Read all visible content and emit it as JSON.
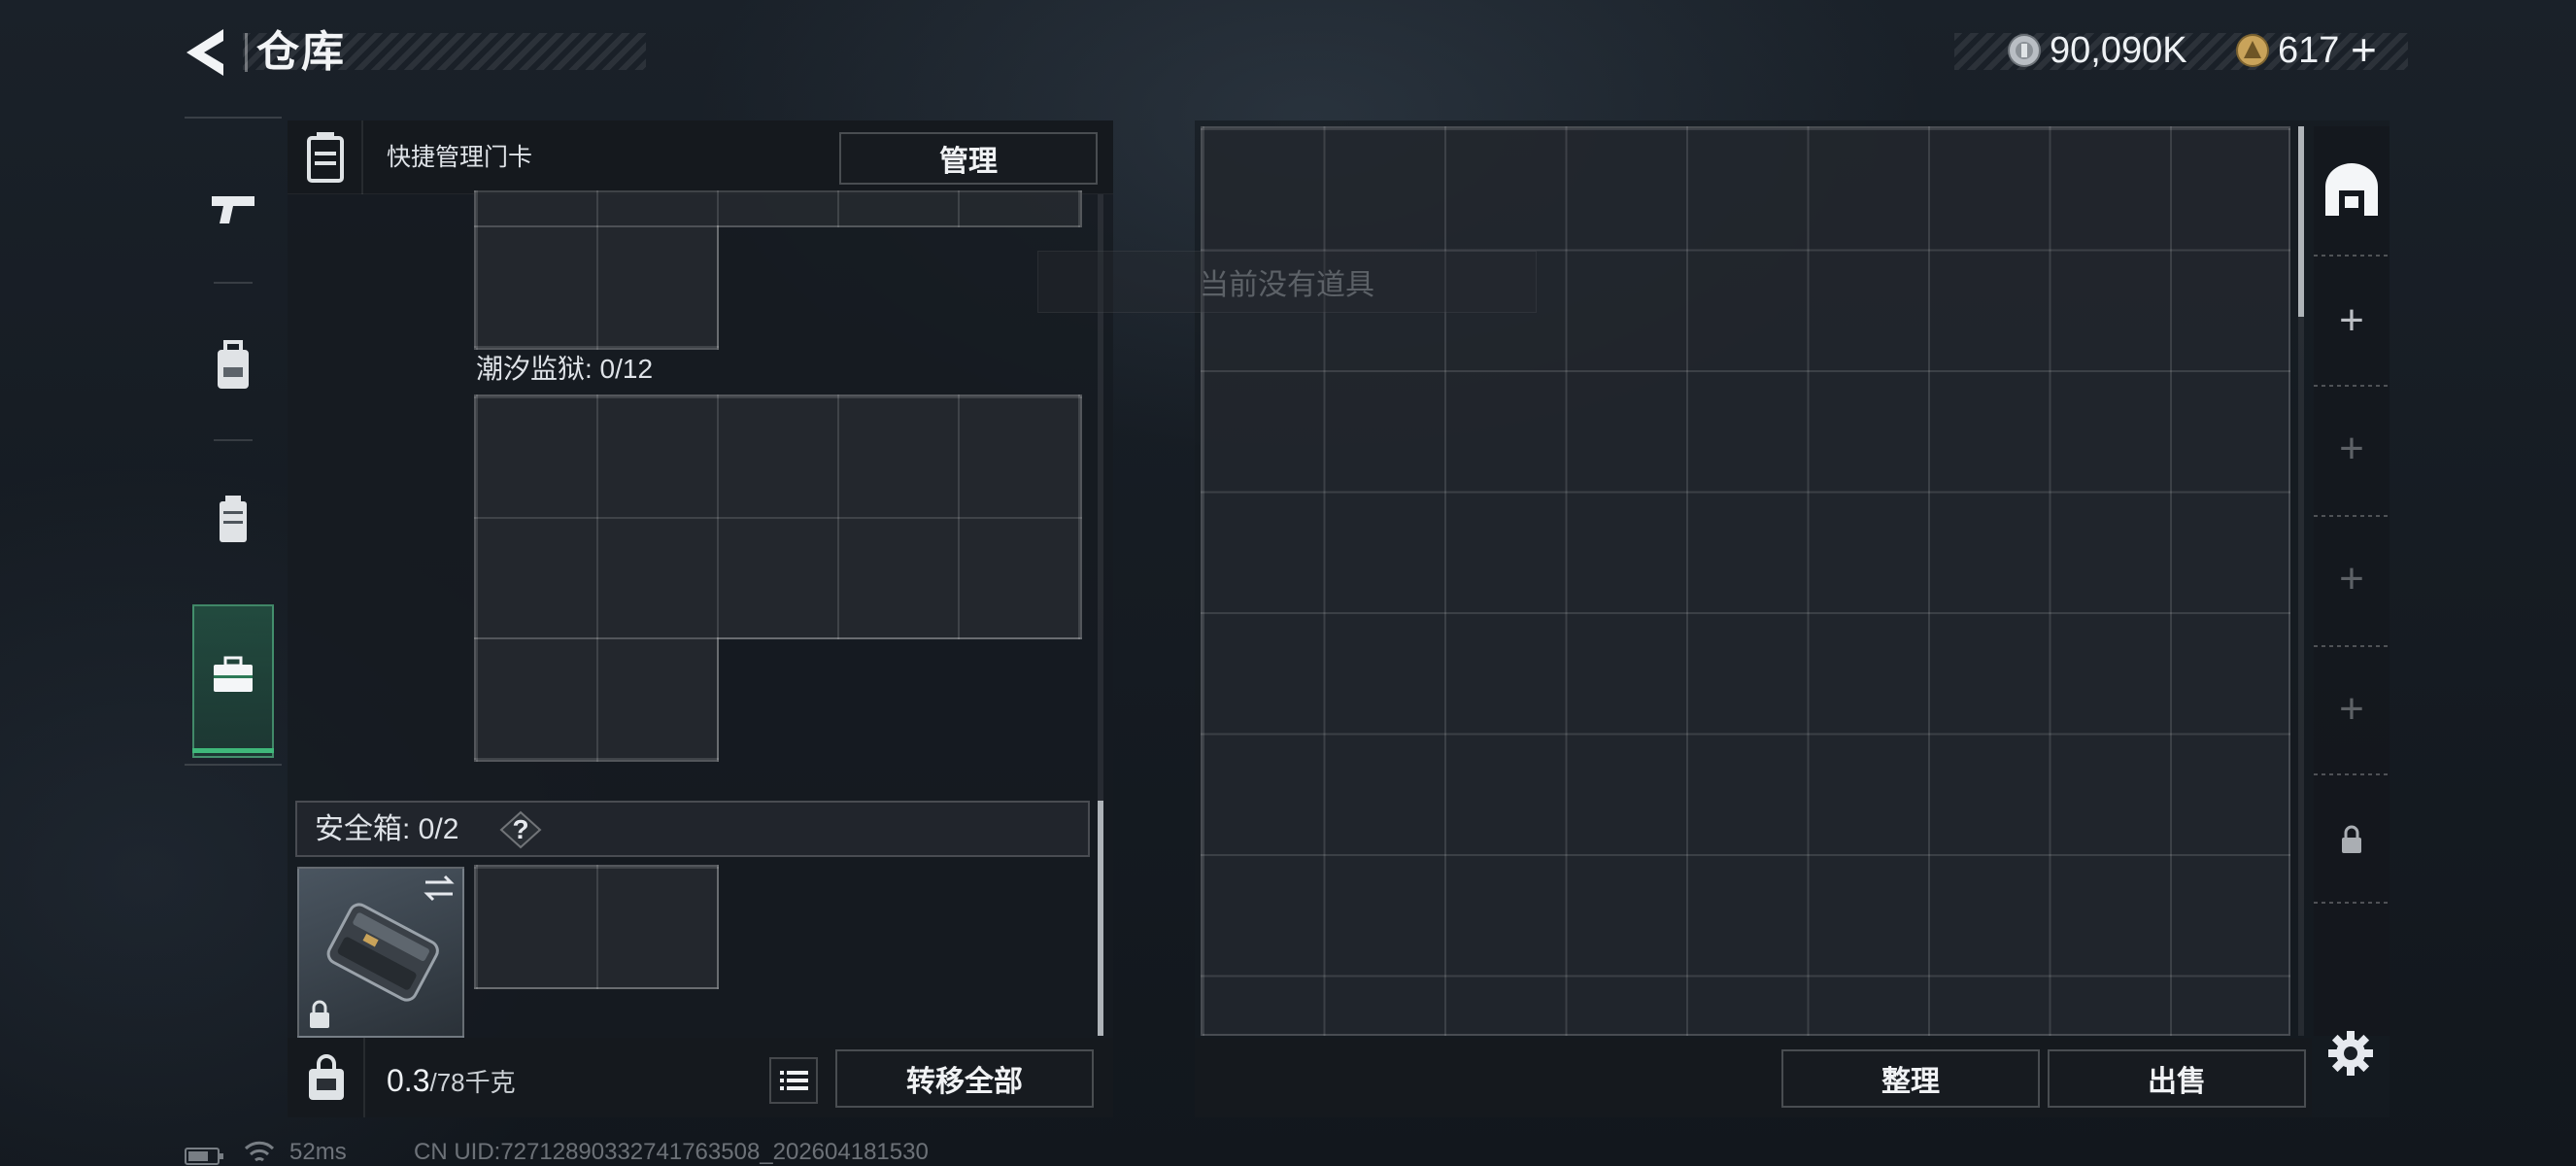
{
  "header": {
    "title": "仓库",
    "currency_silver": "90,090K",
    "currency_gold": "617",
    "add_symbol": "+"
  },
  "side_tabs": [
    {
      "name": "weapon",
      "icon": "pistol-icon"
    },
    {
      "name": "gear",
      "icon": "backpack-icon"
    },
    {
      "name": "chest-rig",
      "icon": "vest-icon"
    },
    {
      "name": "toolbox",
      "icon": "toolbox-icon",
      "active": true
    }
  ],
  "quick_keycard": {
    "label": "快捷管理门卡",
    "manage_button": "管理"
  },
  "keycard_section": {
    "label": "潮汐监狱: 0/12"
  },
  "safe_box": {
    "label": "安全箱: 0/2",
    "help": "?"
  },
  "bottom_bar": {
    "weight_value": "0.3",
    "weight_total": "/78千克",
    "transfer_all": "转移全部"
  },
  "warehouse": {
    "empty_hint": "当前没有道具",
    "sort_button": "整理",
    "sell_button": "出售"
  },
  "right_strip": {
    "plus": "+"
  },
  "status": {
    "ping": "52ms",
    "uid": "CN UID:72712890332741763508_202604181530"
  },
  "colors": {
    "accent_green": "#3fb87a",
    "gold": "#c9a35a",
    "silver": "#b9bec4"
  }
}
